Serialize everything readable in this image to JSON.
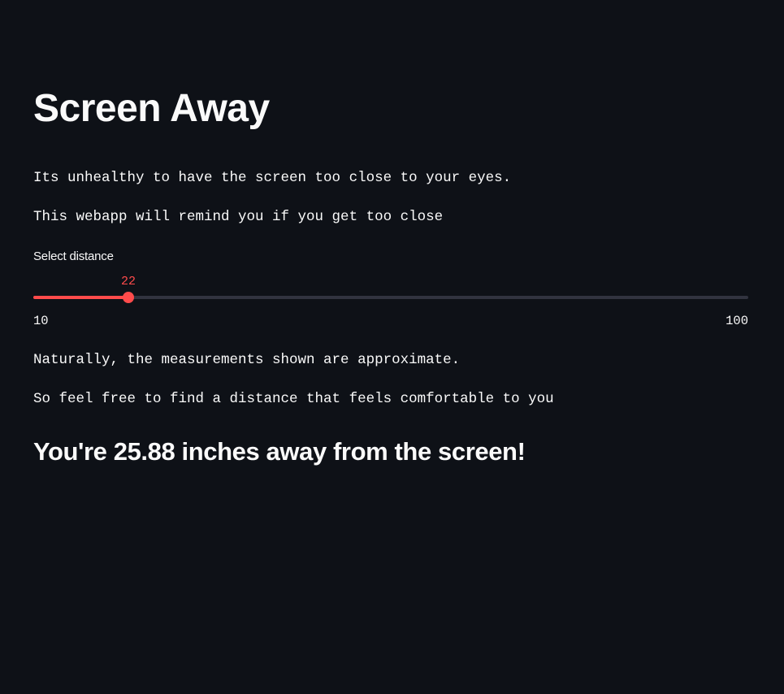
{
  "app": {
    "title": "Screen Away"
  },
  "intro": {
    "line1": "Its unhealthy to have the screen too close to your eyes.",
    "line2": "This webapp will remind you if you get too close"
  },
  "slider": {
    "label": "Select distance",
    "min": 10,
    "max": 100,
    "value": 22,
    "min_label": "10",
    "max_label": "100",
    "value_label": "22",
    "accent_color": "#ff4b4b",
    "track_color": "#31333f"
  },
  "notes": {
    "line1": "Naturally, the measurements shown are approximate.",
    "line2": "So feel free to find a distance that feels comfortable to you"
  },
  "result": {
    "text": "You're 25.88 inches away from the screen!"
  },
  "theme": {
    "background": "#0e1117",
    "text": "#fafafa"
  }
}
